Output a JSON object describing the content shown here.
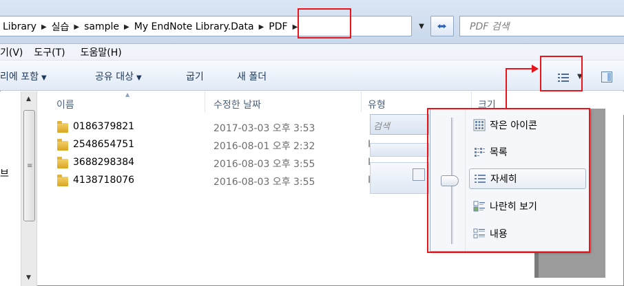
{
  "address_bar": {
    "crumbs": [
      "Library",
      "실습",
      "sample",
      "My EndNote Library.Data",
      "PDF"
    ],
    "search_placeholder": "PDF 검색"
  },
  "menu": {
    "items": [
      "기(V)",
      "도구(T)",
      "도움말(H)"
    ]
  },
  "toolbar": {
    "include_in_library": "리에 포함",
    "share_with": "공유 대상",
    "burn": "굽기",
    "new_folder": "새 폴더"
  },
  "columns": {
    "name": "이름",
    "date_modified": "수정한 날짜",
    "type": "유형",
    "size": "크기"
  },
  "files": [
    {
      "name": "0186379821",
      "date": "2017-03-03 오후 3:53",
      "type": "I"
    },
    {
      "name": "2548654751",
      "date": "2016-08-01 오후 2:32",
      "type": "I"
    },
    {
      "name": "3688298384",
      "date": "2016-08-03 오후 3:55",
      "type": "I"
    },
    {
      "name": "4138718076",
      "date": "2016-08-03 오후 3:55",
      "type": "I"
    }
  ],
  "ghost": {
    "search_text": "검색"
  },
  "nav": {
    "partial_label": "브"
  },
  "view_menu": {
    "items": [
      "작은 아이콘",
      "목록",
      "자세히",
      "나란히 보기",
      "내용"
    ],
    "selected": "자세히"
  },
  "colors": {
    "annotation": "#e8141a",
    "accent": "#1e395b"
  }
}
